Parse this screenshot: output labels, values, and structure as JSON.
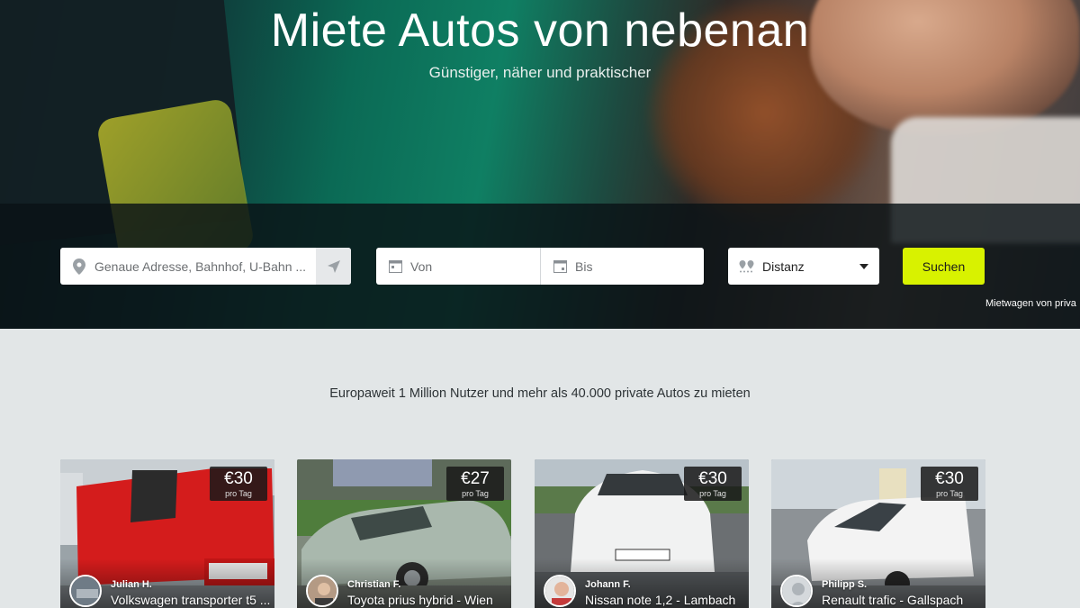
{
  "hero": {
    "title": "Miete Autos von nebenan",
    "subtitle": "Günstiger, näher und praktischer",
    "note": "Mietwagen von priva"
  },
  "search": {
    "address_placeholder": "Genaue Adresse, Bahnhof, U-Bahn ...",
    "from_label": "Von",
    "to_label": "Bis",
    "distance_value": "Distanz",
    "submit_label": "Suchen",
    "accent_color": "#d8f200"
  },
  "main": {
    "tagline": "Europaweit 1 Million Nutzer und mehr als 40.000 private Autos zu mieten"
  },
  "cars": [
    {
      "price": "€30",
      "unit": "pro Tag",
      "owner": "Julian H.",
      "title": "Volkswagen transporter t5 ..."
    },
    {
      "price": "€27",
      "unit": "pro Tag",
      "owner": "Christian F.",
      "title": "Toyota prius hybrid - Wien"
    },
    {
      "price": "€30",
      "unit": "pro Tag",
      "owner": "Johann F.",
      "title": "Nissan note 1,2 - Lambach"
    },
    {
      "price": "€30",
      "unit": "pro Tag",
      "owner": "Philipp S.",
      "title": "Renault trafic - Gallspach"
    }
  ]
}
